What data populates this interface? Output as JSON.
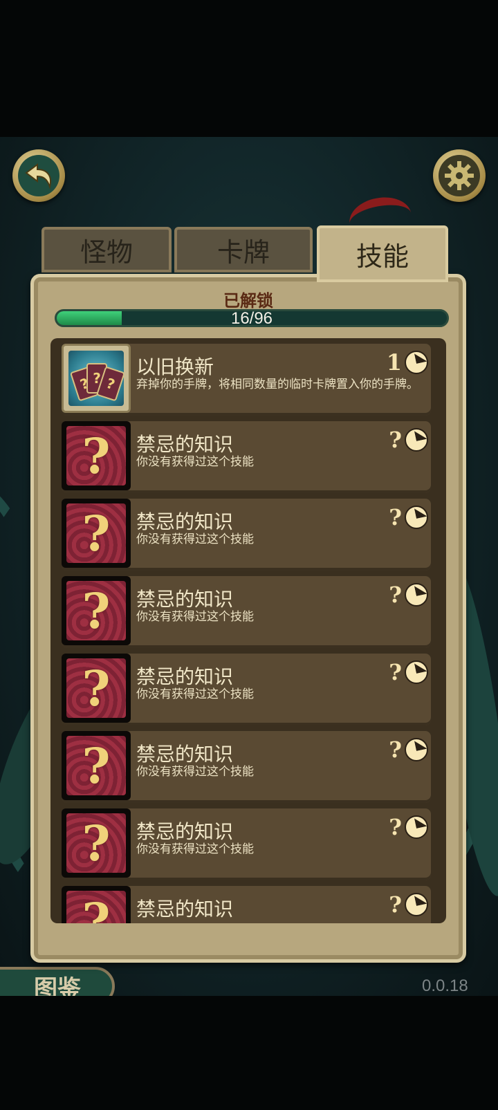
{
  "tabs": [
    {
      "label": "怪物",
      "active": false
    },
    {
      "label": "卡牌",
      "active": false
    },
    {
      "label": "技能",
      "active": true
    }
  ],
  "icons": {
    "back": "back-arrow-icon",
    "settings": "gear-icon",
    "clock": "clock-icon"
  },
  "progress": {
    "title": "已解锁",
    "text": "16/96",
    "unlocked": 16,
    "total": 96
  },
  "skills": [
    {
      "name": "以旧换新",
      "description": "弃掉你的手牌，将相同数量的临时卡牌置入你的手牌。",
      "cost": "1",
      "locked": false
    },
    {
      "name": "禁忌的知识",
      "description": "你没有获得过这个技能",
      "cost": "?",
      "locked": true
    },
    {
      "name": "禁忌的知识",
      "description": "你没有获得过这个技能",
      "cost": "?",
      "locked": true
    },
    {
      "name": "禁忌的知识",
      "description": "你没有获得过这个技能",
      "cost": "?",
      "locked": true
    },
    {
      "name": "禁忌的知识",
      "description": "你没有获得过这个技能",
      "cost": "?",
      "locked": true
    },
    {
      "name": "禁忌的知识",
      "description": "你没有获得过这个技能",
      "cost": "?",
      "locked": true
    },
    {
      "name": "禁忌的知识",
      "description": "你没有获得过这个技能",
      "cost": "?",
      "locked": true
    },
    {
      "name": "禁忌的知识",
      "description": "",
      "cost": "?",
      "locked": true
    }
  ],
  "codex_button": "图鉴",
  "version": "0.0.18",
  "colors": {
    "progress_fill": "#3fd07a",
    "panel": "#b7a77e",
    "item": "#5a4a33",
    "title_text": "#5a2a14"
  }
}
